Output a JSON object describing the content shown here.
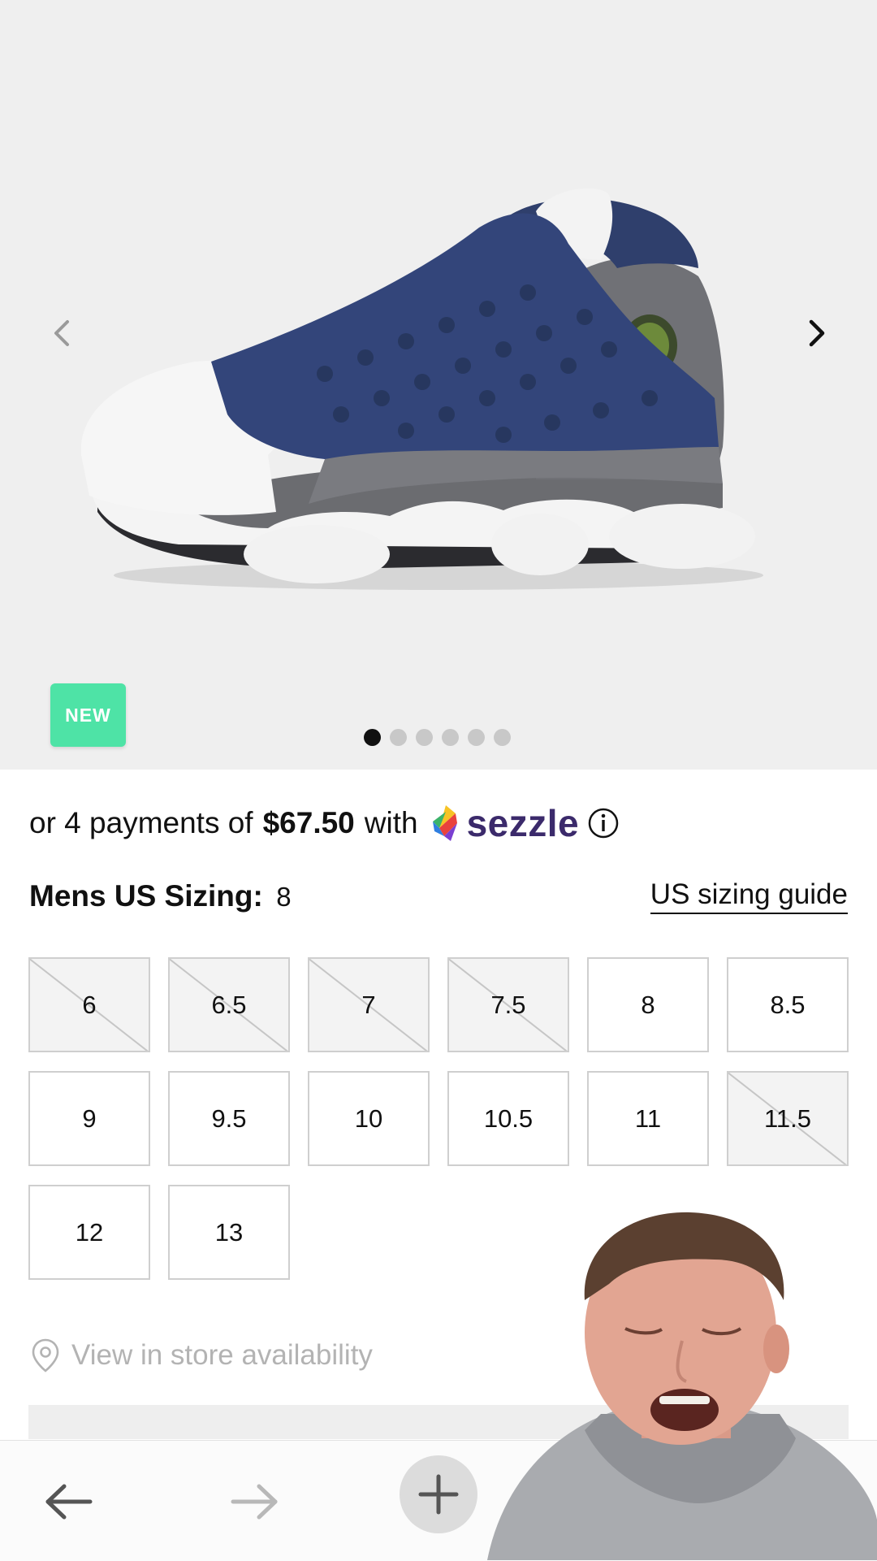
{
  "hero": {
    "badge": "NEW",
    "image_alt": "",
    "slides_total": 6,
    "active_slide": 1
  },
  "payments": {
    "prefix": "or 4 payments of",
    "amount": "$67.50",
    "middle": "with",
    "provider": "sezzle"
  },
  "sizing": {
    "title": "Mens US Sizing:",
    "selected": "8",
    "guide_link": "US sizing guide",
    "sizes": [
      {
        "label": "6",
        "available": false
      },
      {
        "label": "6.5",
        "available": false
      },
      {
        "label": "7",
        "available": false
      },
      {
        "label": "7.5",
        "available": false
      },
      {
        "label": "8",
        "available": true
      },
      {
        "label": "8.5",
        "available": true
      },
      {
        "label": "9",
        "available": true
      },
      {
        "label": "9.5",
        "available": true
      },
      {
        "label": "10",
        "available": true
      },
      {
        "label": "10.5",
        "available": true
      },
      {
        "label": "11",
        "available": true
      },
      {
        "label": "11.5",
        "available": false
      },
      {
        "label": "12",
        "available": true
      },
      {
        "label": "13",
        "available": true
      }
    ]
  },
  "store": {
    "label": "View in store availability"
  },
  "colors": {
    "badge": "#4ee3a6",
    "sezzle_text": "#3b2a6b",
    "muted_text": "#b3b3b3"
  }
}
